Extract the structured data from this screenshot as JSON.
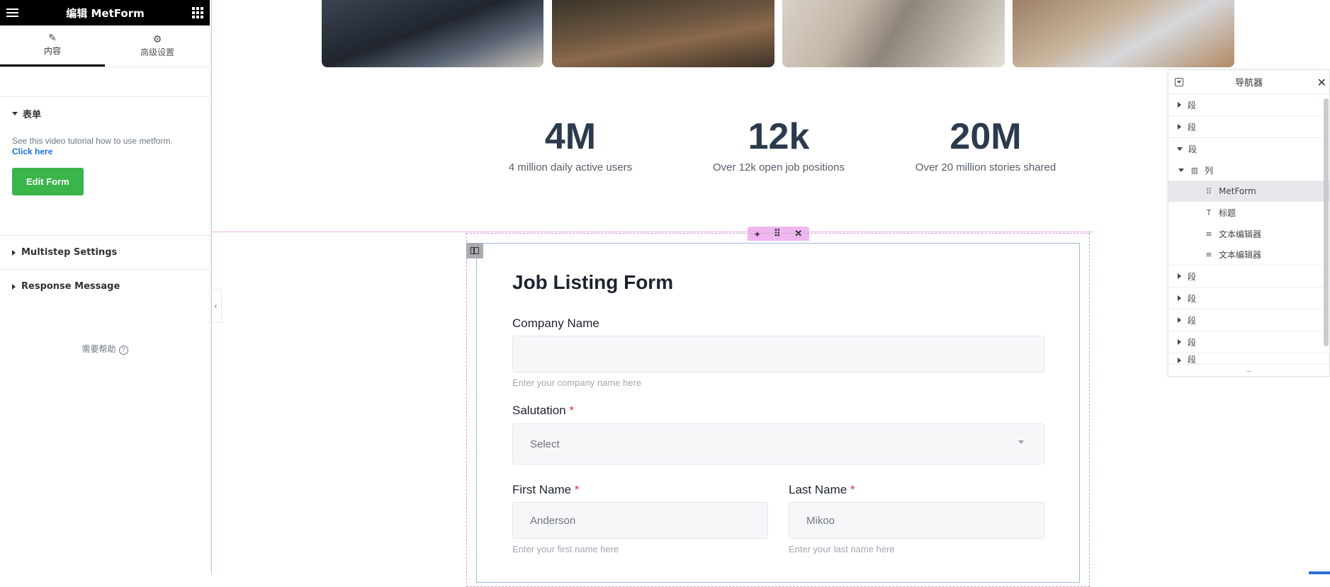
{
  "panel": {
    "title": "编辑 MetForm",
    "tabs": [
      {
        "label": "内容",
        "icon": "pencil-icon"
      },
      {
        "label": "高级设置",
        "icon": "gear-icon"
      }
    ],
    "sections": {
      "form": {
        "title": "表单",
        "tutorial_text": "See this video tutorial how to use metform.",
        "link_text": "Click here",
        "button_label": "Edit Form"
      },
      "multistep": {
        "title": "Multistep Settings"
      },
      "response": {
        "title": "Response Message"
      }
    },
    "help_label": "需要帮助",
    "help_icon": "?"
  },
  "stats": [
    {
      "value": "4M",
      "label": "4 million daily active users"
    },
    {
      "value": "12k",
      "label": "Over 12k open job positions"
    },
    {
      "value": "20M",
      "label": "Over 20 million stories shared"
    }
  ],
  "section_toolbar": {
    "add": "+",
    "drag": "⠿",
    "close": "✕"
  },
  "form": {
    "title": "Job Listing Form",
    "company": {
      "label": "Company Name",
      "value": "",
      "help": "Enter your company name here"
    },
    "salutation": {
      "label": "Salutation",
      "required_mark": "*",
      "value": "Select"
    },
    "first_name": {
      "label": "First Name",
      "required_mark": "*",
      "value": "Anderson",
      "help": "Enter your first name here"
    },
    "last_name": {
      "label": "Last Name",
      "required_mark": "*",
      "value": "Mikoo",
      "help": "Enter your last name here"
    }
  },
  "navigator": {
    "title": "导航器",
    "close": "✕",
    "rows": [
      {
        "label": "段"
      },
      {
        "label": "段"
      },
      {
        "label": "段"
      },
      {
        "label": "列"
      },
      {
        "label": "MetForm"
      },
      {
        "label": "标题"
      },
      {
        "label": "文本编辑器"
      },
      {
        "label": "文本编辑器"
      },
      {
        "label": "段"
      },
      {
        "label": "段"
      },
      {
        "label": "段"
      },
      {
        "label": "段"
      },
      {
        "label": "段"
      }
    ],
    "footer": "..."
  },
  "colors": {
    "accent_green": "#39b54a",
    "link_blue": "#1a6fd6",
    "section_pink": "#f0b6f0",
    "widget_blue": "#9fb7e0",
    "required_red": "#d63638"
  }
}
